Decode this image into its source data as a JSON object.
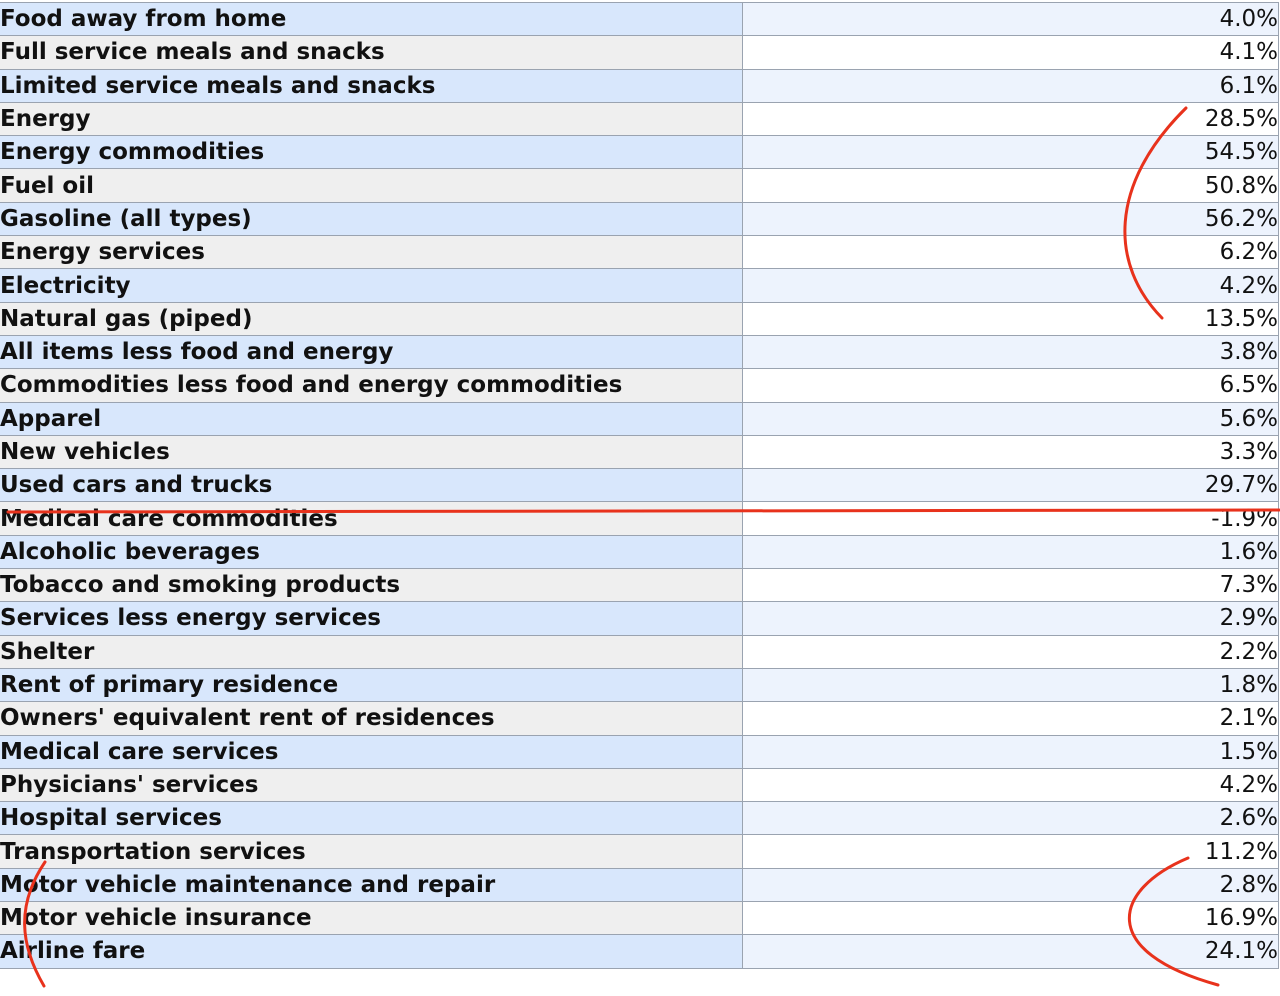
{
  "colors": {
    "label_row_blue": "#d8e7fc",
    "label_row_gray": "#efefef",
    "value_row_blue": "#edf3fd",
    "value_row_white": "#ffffff",
    "grid_line": "#9aa3b0",
    "annotation_red": "#e8321c"
  },
  "rows": [
    {
      "label": "Food away from home",
      "value": "4.0%",
      "level": 1
    },
    {
      "label": "Full service meals and snacks",
      "value": "4.1%",
      "level": 2
    },
    {
      "label": "Limited service meals and snacks",
      "value": "6.1%",
      "level": 2
    },
    {
      "label": "Energy",
      "value": "28.5%",
      "level": 0
    },
    {
      "label": "Energy commodities",
      "value": "54.5%",
      "level": 1
    },
    {
      "label": "Fuel oil",
      "value": "50.8%",
      "level": 2
    },
    {
      "label": "Gasoline (all types)",
      "value": "56.2%",
      "level": 2
    },
    {
      "label": "Energy services",
      "value": "6.2%",
      "level": 1
    },
    {
      "label": "Electricity",
      "value": "4.2%",
      "level": 2
    },
    {
      "label": "Natural gas (piped)",
      "value": "13.5%",
      "level": 2
    },
    {
      "label": "All items less food and energy",
      "value": "3.8%",
      "level": 0
    },
    {
      "label": "Commodities less food and energy commodities",
      "value": "6.5%",
      "level": 1
    },
    {
      "label": "Apparel",
      "value": "5.6%",
      "level": 2
    },
    {
      "label": "New vehicles",
      "value": "3.3%",
      "level": 2
    },
    {
      "label": "Used cars and trucks",
      "value": "29.7%",
      "level": 2
    },
    {
      "label": "Medical care commodities",
      "value": "-1.9%",
      "level": 2
    },
    {
      "label": "Alcoholic beverages",
      "value": "1.6%",
      "level": 2
    },
    {
      "label": "Tobacco and smoking products",
      "value": "7.3%",
      "level": 2
    },
    {
      "label": "Services less energy services",
      "value": "2.9%",
      "level": 1
    },
    {
      "label": "Shelter",
      "value": "2.2%",
      "level": 2
    },
    {
      "label": "Rent of primary residence",
      "value": "1.8%",
      "level": 3
    },
    {
      "label": "Owners' equivalent rent of residences",
      "value": "2.1%",
      "level": 3
    },
    {
      "label": "Medical care services",
      "value": "1.5%",
      "level": 2
    },
    {
      "label": "Physicians' services",
      "value": "4.2%",
      "level": 3
    },
    {
      "label": "Hospital services",
      "value": "2.6%",
      "level": 3
    },
    {
      "label": "Transportation services",
      "value": "11.2%",
      "level": 2
    },
    {
      "label": "Motor vehicle maintenance and repair",
      "value": "2.8%",
      "level": 3
    },
    {
      "label": "Motor vehicle insurance",
      "value": "16.9%",
      "level": 3
    },
    {
      "label": "Airline fare",
      "value": "24.1%",
      "level": 3
    }
  ],
  "annotations": [
    {
      "type": "bracket-curve",
      "name": "energy-values-bracket"
    },
    {
      "type": "underline",
      "name": "used-cars-underline"
    },
    {
      "type": "bracket-curve",
      "name": "transport-label-bracket"
    },
    {
      "type": "bracket-curve",
      "name": "transport-values-bracket"
    }
  ]
}
